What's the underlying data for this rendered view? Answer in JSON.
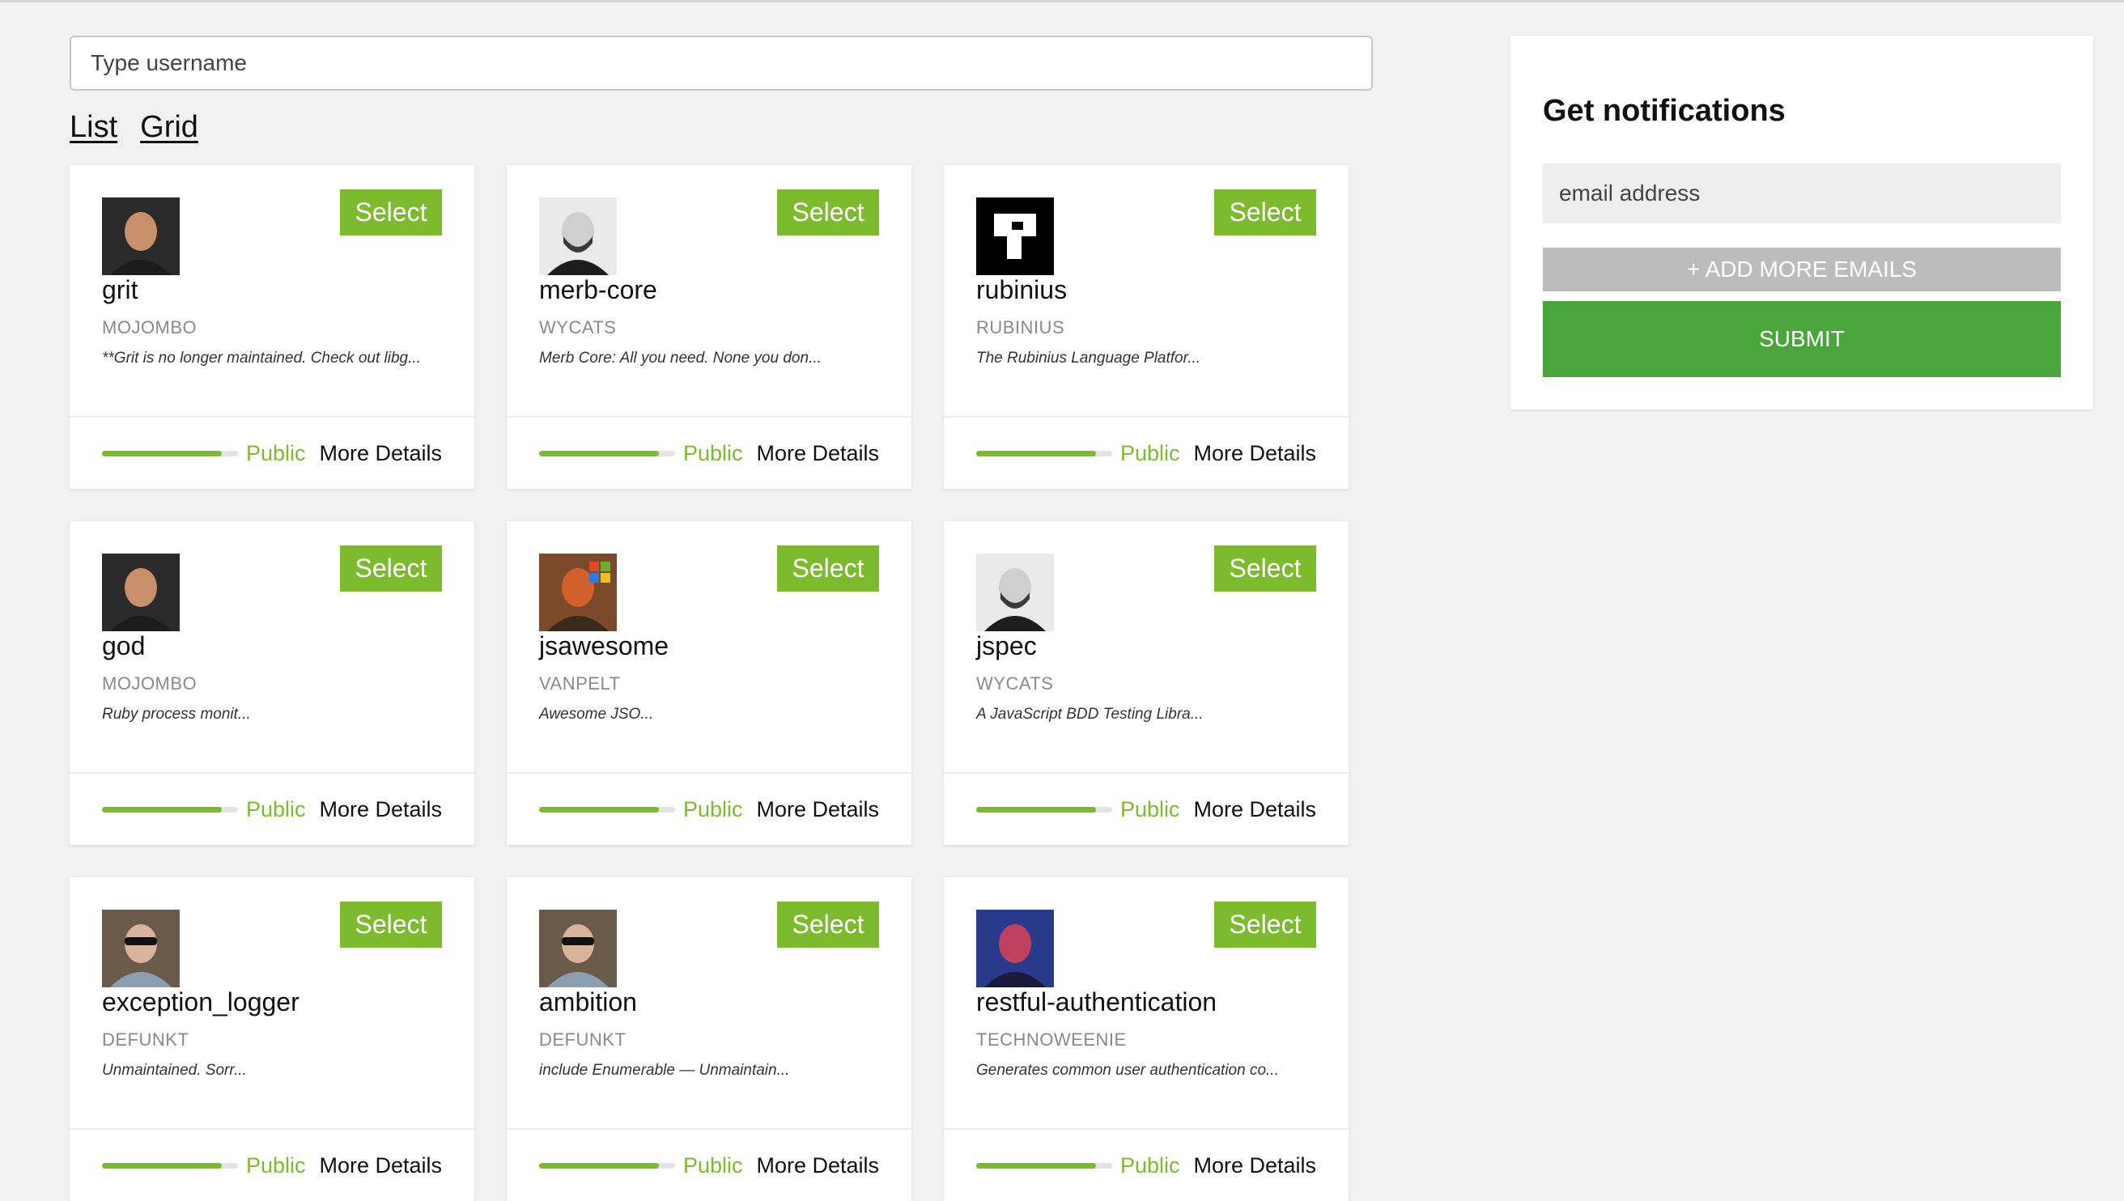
{
  "search": {
    "placeholder": "Type username"
  },
  "view_toggle": {
    "list_label": "List",
    "grid_label": "Grid"
  },
  "cards": [
    {
      "name": "grit",
      "owner": "MOJOMBO",
      "description": "**Grit is no longer maintained. Check out libg...",
      "select_label": "Select",
      "visibility": "Public",
      "details_label": "More Details",
      "progress": 0.88,
      "avatar": "portrait-dark",
      "avatar_colors": [
        "#2a2a2a",
        "#c8906a",
        "#1c1c1c"
      ]
    },
    {
      "name": "merb-core",
      "owner": "WYCATS",
      "description": "Merb Core: All you need. None you don...",
      "select_label": "Select",
      "visibility": "Public",
      "details_label": "More Details",
      "progress": 0.88,
      "avatar": "portrait-bearded",
      "avatar_colors": [
        "#eaeaea",
        "#cfcfcf",
        "#1d1d1d"
      ]
    },
    {
      "name": "rubinius",
      "owner": "RUBINIUS",
      "description": "The Rubinius Language Platfor...",
      "select_label": "Select",
      "visibility": "Public",
      "details_label": "More Details",
      "progress": 0.88,
      "avatar": "logo-r",
      "avatar_colors": [
        "#000000",
        "#ffffff",
        "#000000"
      ]
    },
    {
      "name": "god",
      "owner": "MOJOMBO",
      "description": "Ruby process monit...",
      "select_label": "Select",
      "visibility": "Public",
      "details_label": "More Details",
      "progress": 0.88,
      "avatar": "portrait-dark",
      "avatar_colors": [
        "#2a2a2a",
        "#c8906a",
        "#1c1c1c"
      ]
    },
    {
      "name": "jsawesome",
      "owner": "VANPELT",
      "description": "Awesome JSO...",
      "select_label": "Select",
      "visibility": "Public",
      "details_label": "More Details",
      "progress": 0.88,
      "avatar": "portrait-orange",
      "avatar_colors": [
        "#7a4a2a",
        "#d2602a",
        "#3a2a1a"
      ]
    },
    {
      "name": "jspec",
      "owner": "WYCATS",
      "description": "A JavaScript BDD Testing Libra...",
      "select_label": "Select",
      "visibility": "Public",
      "details_label": "More Details",
      "progress": 0.88,
      "avatar": "portrait-bearded",
      "avatar_colors": [
        "#eaeaea",
        "#cfcfcf",
        "#1d1d1d"
      ]
    },
    {
      "name": "exception_logger",
      "owner": "DEFUNKT",
      "description": "Unmaintained. Sorr...",
      "select_label": "Select",
      "visibility": "Public",
      "details_label": "More Details",
      "progress": 0.88,
      "avatar": "portrait-sunglasses",
      "avatar_colors": [
        "#6a5a4a",
        "#d8b49a",
        "#8aa0b0"
      ]
    },
    {
      "name": "ambition",
      "owner": "DEFUNKT",
      "description": "include Enumerable — Unmaintain...",
      "select_label": "Select",
      "visibility": "Public",
      "details_label": "More Details",
      "progress": 0.88,
      "avatar": "portrait-sunglasses",
      "avatar_colors": [
        "#6a5a4a",
        "#d8b49a",
        "#8aa0b0"
      ]
    },
    {
      "name": "restful-authentication",
      "owner": "TECHNOWEENIE",
      "description": "Generates common user authentication co...",
      "select_label": "Select",
      "visibility": "Public",
      "details_label": "More Details",
      "progress": 0.88,
      "avatar": "portrait-neon",
      "avatar_colors": [
        "#2a3a8a",
        "#c04060",
        "#1a1a3a"
      ]
    }
  ],
  "notifications": {
    "title": "Get notifications",
    "email_placeholder": "email address",
    "add_emails_label": "+ ADD MORE EMAILS",
    "submit_label": "SUBMIT"
  },
  "colors": {
    "accent": "#7dbb2e",
    "submit": "#4aa63c",
    "add_emails": "#bcbcbc",
    "background": "#f2f2f2"
  }
}
